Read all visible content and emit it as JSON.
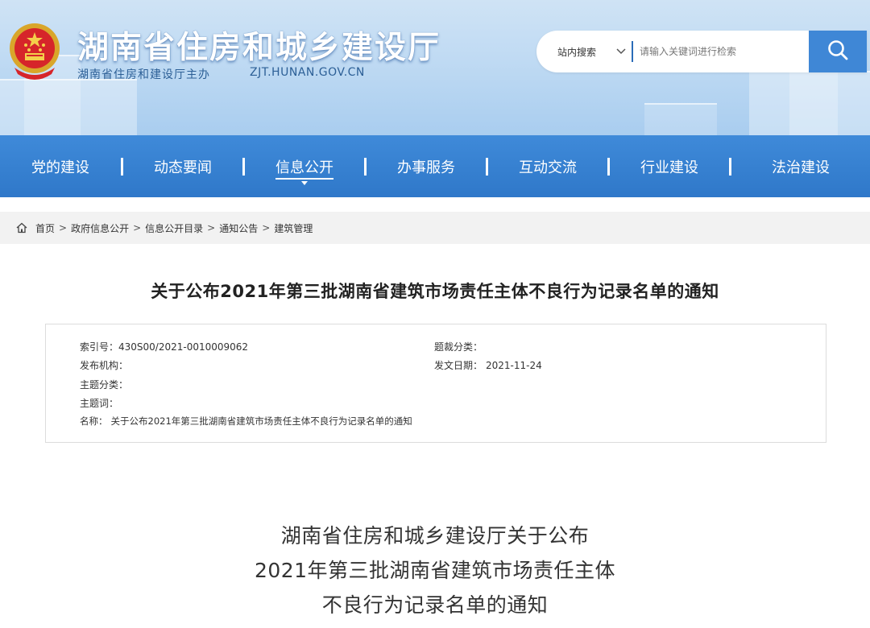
{
  "header": {
    "title": "湖南省住房和城乡建设厅",
    "sponsor": "湖南省住房和建设厅主办",
    "domain": "ZJT.HUNAN.GOV.CN"
  },
  "search": {
    "scope": "站内搜索",
    "placeholder": "请输入关键词进行检索"
  },
  "nav": {
    "items": [
      "党的建设",
      "动态要闻",
      "信息公开",
      "办事服务",
      "互动交流",
      "行业建设",
      "法治建设"
    ],
    "active": "信息公开"
  },
  "breadcrumb": [
    "首页",
    "政府信息公开",
    "信息公开目录",
    "通知公告",
    "建筑管理"
  ],
  "article": {
    "title": "关于公布2021年第三批湖南省建筑市场责任主体不良行为记录名单的通知",
    "meta": {
      "index_label": "索引号：",
      "index_value": "430S00/2021-0010009062",
      "publisher_label": "发布机构：",
      "publisher_value": "",
      "topic_label": "主题分类：",
      "topic_value": "",
      "keywords_label": "主题词：",
      "keywords_value": "",
      "name_label": "名称：",
      "name_value": "关于公布2021年第三批湖南省建筑市场责任主体不良行为记录名单的通知",
      "genre_label": "题裁分类：",
      "genre_value": "",
      "date_label": "发文日期：",
      "date_value": "2021-11-24"
    },
    "heading_lines": [
      "湖南省住房和城乡建设厅关于公布",
      "2021年第三批湖南省建筑市场责任主体",
      "不良行为记录名单的通知"
    ]
  },
  "colors": {
    "nav_bg": "#3383d4",
    "search_button": "#3f87d6",
    "banner_bg": "#bfdaf3"
  },
  "icons": [
    "national-emblem-icon",
    "chevron-down-icon",
    "search-icon",
    "home-icon"
  ]
}
